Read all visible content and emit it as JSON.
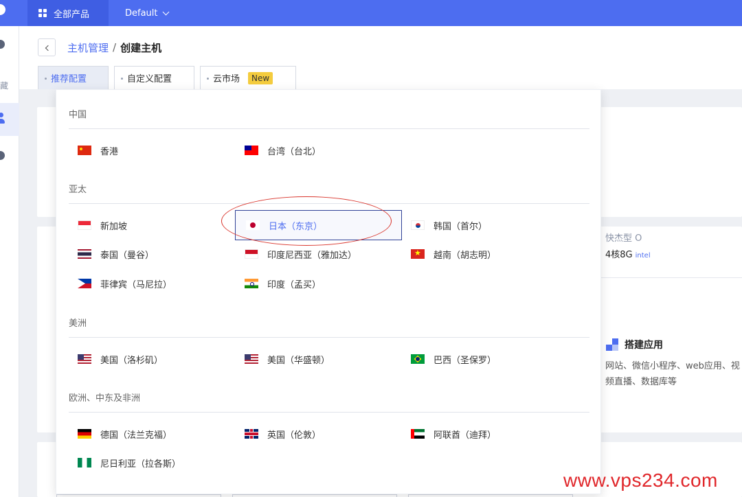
{
  "topbar": {
    "products_label": "全部产品",
    "env_label": "Default"
  },
  "sidebar": {
    "partial_text": "藏"
  },
  "breadcrumb": {
    "parent": "主机管理",
    "separator": "/",
    "current": "创建主机"
  },
  "tabs": [
    {
      "label": "推荐配置",
      "active": true
    },
    {
      "label": "自定义配置",
      "active": false
    },
    {
      "label": "云市场",
      "active": false,
      "badge": "New"
    }
  ],
  "side_panel": {
    "spec_name": "快杰型 O",
    "spec_cpu": "4核8G",
    "spec_cpu_brand": "intel",
    "app_title": "搭建应用",
    "app_desc": "网站、微信小程序、web应用、视频直播、数据库等"
  },
  "dropdown": {
    "regions": [
      {
        "name": "中国",
        "locations": [
          {
            "label": "香港",
            "flag": "cn"
          },
          {
            "label": "台湾（台北）",
            "flag": "tw"
          }
        ]
      },
      {
        "name": "亚太",
        "locations": [
          {
            "label": "新加坡",
            "flag": "sg"
          },
          {
            "label": "日本（东京）",
            "flag": "jp",
            "selected": true
          },
          {
            "label": "韩国（首尔）",
            "flag": "kr"
          },
          {
            "label": "泰国（曼谷）",
            "flag": "th"
          },
          {
            "label": "印度尼西亚（雅加达）",
            "flag": "id"
          },
          {
            "label": "越南（胡志明）",
            "flag": "vn"
          },
          {
            "label": "菲律宾（马尼拉）",
            "flag": "ph"
          },
          {
            "label": "印度（孟买）",
            "flag": "in"
          }
        ]
      },
      {
        "name": "美洲",
        "locations": [
          {
            "label": "美国（洛杉矶）",
            "flag": "us"
          },
          {
            "label": "美国（华盛顿）",
            "flag": "us"
          },
          {
            "label": "巴西（圣保罗）",
            "flag": "br"
          }
        ]
      },
      {
        "name": "欧洲、中东及非洲",
        "locations": [
          {
            "label": "德国（法兰克福）",
            "flag": "de"
          },
          {
            "label": "英国（伦敦）",
            "flag": "gb"
          },
          {
            "label": "阿联酋（迪拜）",
            "flag": "ae"
          },
          {
            "label": "尼日利亚（拉各斯）",
            "flag": "ng"
          }
        ]
      }
    ]
  },
  "watermark": "www.vps234.com",
  "colors": {
    "primary": "#4d6df0",
    "topbar": "#4d6df0",
    "badge": "#f4cc3e",
    "annotation": "#d9342b",
    "watermark": "#e0262a"
  }
}
